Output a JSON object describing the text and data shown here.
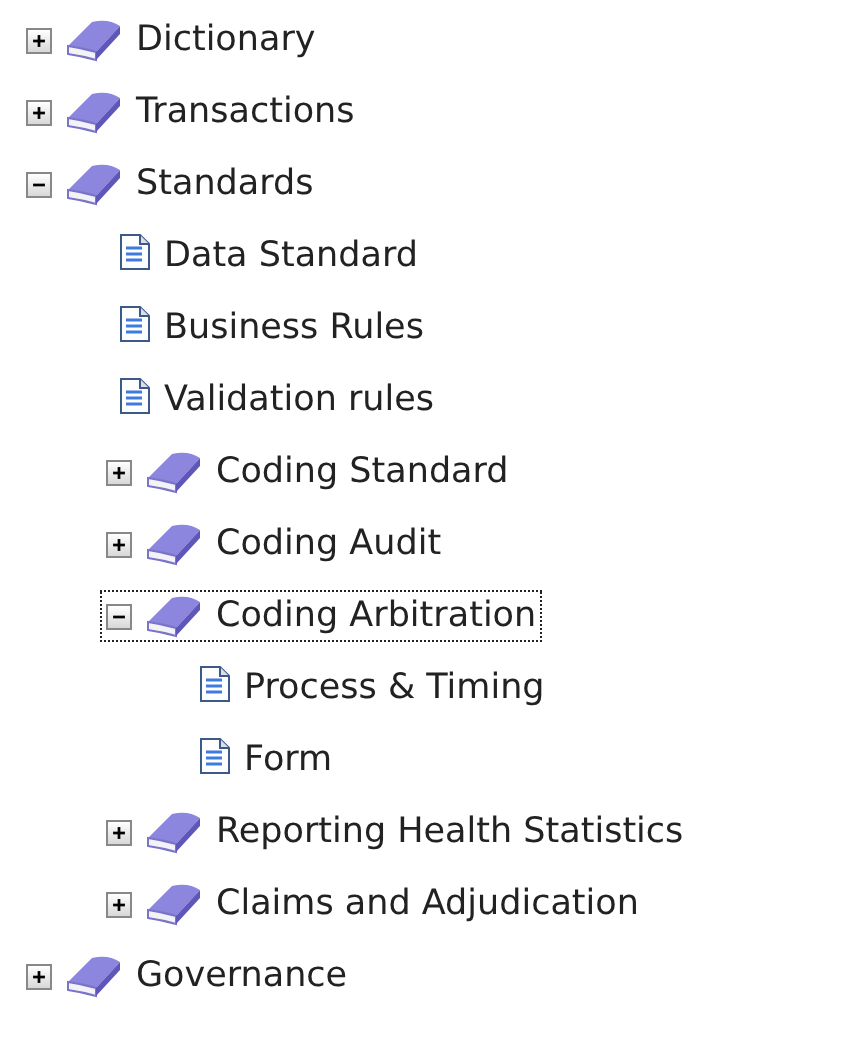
{
  "tree": [
    {
      "label": "Dictionary",
      "kind": "book",
      "expanded": false,
      "selected": false
    },
    {
      "label": "Transactions",
      "kind": "book",
      "expanded": false,
      "selected": false
    },
    {
      "label": "Standards",
      "kind": "book",
      "expanded": true,
      "selected": false,
      "children": [
        {
          "label": "Data Standard",
          "kind": "page",
          "selected": false
        },
        {
          "label": "Business Rules",
          "kind": "page",
          "selected": false
        },
        {
          "label": "Validation rules",
          "kind": "page",
          "selected": false
        },
        {
          "label": "Coding Standard",
          "kind": "book",
          "expanded": false,
          "selected": false
        },
        {
          "label": "Coding Audit",
          "kind": "book",
          "expanded": false,
          "selected": false
        },
        {
          "label": "Coding Arbitration",
          "kind": "book",
          "expanded": true,
          "selected": true,
          "children": [
            {
              "label": "Process & Timing",
              "kind": "page",
              "selected": false
            },
            {
              "label": "Form",
              "kind": "page",
              "selected": false
            }
          ]
        },
        {
          "label": "Reporting Health Statistics",
          "kind": "book",
          "expanded": false,
          "selected": false
        },
        {
          "label": "Claims and Adjudication",
          "kind": "book",
          "expanded": false,
          "selected": false
        }
      ]
    },
    {
      "label": "Governance",
      "kind": "book",
      "expanded": false,
      "selected": false
    }
  ]
}
